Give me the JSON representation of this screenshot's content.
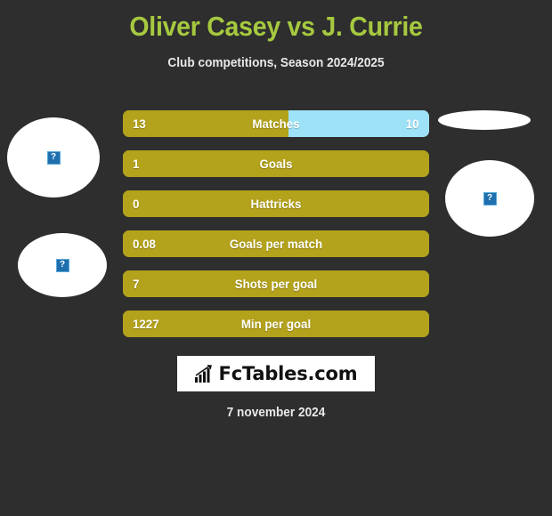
{
  "header": {
    "title": "Oliver Casey vs J. Currie",
    "subtitle": "Club competitions, Season 2024/2025",
    "title_color": "#a6c93f"
  },
  "players": {
    "left": {
      "name": "Oliver Casey",
      "photo_alt": "?",
      "photo_status": "broken-image"
    },
    "right": {
      "name": "J. Currie",
      "photo_alt": "?",
      "photo_status": "broken-image"
    }
  },
  "colors": {
    "background": "#2e2e2e",
    "left_player_bar": "#b3a21b",
    "right_player_bar": "#9ee2f7",
    "accent_title": "#a6c93f",
    "text": "#ffffff"
  },
  "stats": [
    {
      "label": "Matches",
      "left_value": "13",
      "right_value": "10",
      "left_pct": 54,
      "right_pct": 46,
      "has_right": true
    },
    {
      "label": "Goals",
      "left_value": "1",
      "right_value": "",
      "left_pct": 100,
      "right_pct": 0,
      "has_right": false
    },
    {
      "label": "Hattricks",
      "left_value": "0",
      "right_value": "",
      "left_pct": 100,
      "right_pct": 0,
      "has_right": false
    },
    {
      "label": "Goals per match",
      "left_value": "0.08",
      "right_value": "",
      "left_pct": 100,
      "right_pct": 0,
      "has_right": false
    },
    {
      "label": "Shots per goal",
      "left_value": "7",
      "right_value": "",
      "left_pct": 100,
      "right_pct": 0,
      "has_right": false
    },
    {
      "label": "Min per goal",
      "left_value": "1227",
      "right_value": "",
      "left_pct": 100,
      "right_pct": 0,
      "has_right": false
    }
  ],
  "logo": {
    "text": "FcTables.com",
    "icon": "bar-chart-growth-icon"
  },
  "footer": {
    "date": "7 november 2024"
  }
}
